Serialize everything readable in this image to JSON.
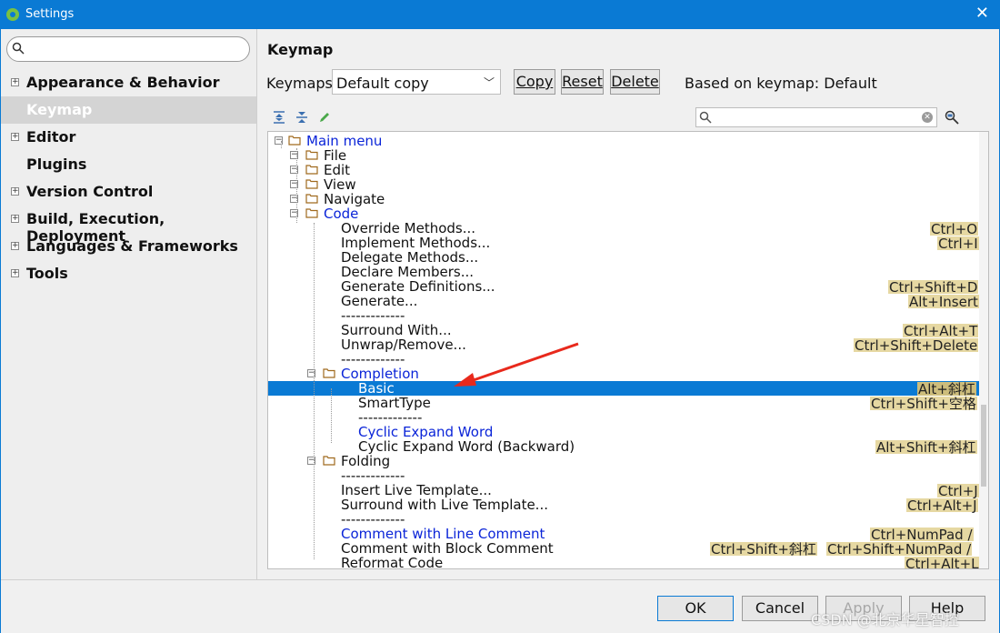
{
  "window": {
    "title": "Settings",
    "close": "✕"
  },
  "sidebar": {
    "items": [
      {
        "label": "Appearance & Behavior",
        "expand": "+"
      },
      {
        "label": "Keymap"
      },
      {
        "label": "Editor",
        "expand": "+"
      },
      {
        "label": "Plugins"
      },
      {
        "label": "Version Control",
        "expand": "+"
      },
      {
        "label": "Build, Execution, Deployment",
        "expand": "+"
      },
      {
        "label": "Languages & Frameworks",
        "expand": "+"
      },
      {
        "label": "Tools",
        "expand": "+"
      }
    ]
  },
  "keymap": {
    "heading": "Keymap",
    "keymaps_label": "Keymaps:",
    "selected_keymap": "Default copy",
    "copy_label": "Copy",
    "reset_label": "Reset",
    "delete_label": "Delete",
    "based_on": "Based on keymap: Default"
  },
  "tree": {
    "rows": [
      {
        "text": "Main menu",
        "blue": true
      },
      {
        "text": "File"
      },
      {
        "text": "Edit"
      },
      {
        "text": "View"
      },
      {
        "text": "Navigate"
      },
      {
        "text": "Code",
        "blue": true
      },
      {
        "text": "Override Methods...",
        "shortcuts": [
          "Ctrl+O"
        ]
      },
      {
        "text": "Implement Methods...",
        "shortcuts": [
          "Ctrl+I"
        ]
      },
      {
        "text": "Delegate Methods..."
      },
      {
        "text": "Declare Members..."
      },
      {
        "text": "Generate Definitions...",
        "shortcuts": [
          "Ctrl+Shift+D"
        ]
      },
      {
        "text": "Generate...",
        "shortcuts": [
          "Alt+Insert"
        ]
      },
      {
        "text": "-------------"
      },
      {
        "text": "Surround With...",
        "shortcuts": [
          "Ctrl+Alt+T"
        ]
      },
      {
        "text": "Unwrap/Remove...",
        "shortcuts": [
          "Ctrl+Shift+Delete"
        ]
      },
      {
        "text": "-------------"
      },
      {
        "text": "Completion",
        "blue": true
      },
      {
        "text": "Basic",
        "shortcuts": [
          "Alt+斜杠"
        ]
      },
      {
        "text": "SmartType",
        "shortcuts": [
          "Ctrl+Shift+空格"
        ]
      },
      {
        "text": "-------------"
      },
      {
        "text": "Cyclic Expand Word",
        "blue": true
      },
      {
        "text": "Cyclic Expand Word (Backward)",
        "shortcuts": [
          "Alt+Shift+斜杠"
        ]
      },
      {
        "text": "Folding"
      },
      {
        "text": "-------------"
      },
      {
        "text": "Insert Live Template...",
        "shortcuts": [
          "Ctrl+J"
        ]
      },
      {
        "text": "Surround with Live Template...",
        "shortcuts": [
          "Ctrl+Alt+J"
        ]
      },
      {
        "text": "-------------"
      },
      {
        "text": "Comment with Line Comment",
        "blue": true,
        "shortcuts": [
          "Ctrl+NumPad /"
        ]
      },
      {
        "text": "Comment with Block Comment",
        "shortcuts": [
          "Ctrl+Shift+斜杠",
          "Ctrl+Shift+NumPad /"
        ]
      },
      {
        "text": "Reformat Code",
        "shortcuts": [
          "Ctrl+Alt+L"
        ]
      }
    ]
  },
  "footer": {
    "ok": "OK",
    "cancel": "Cancel",
    "apply": "Apply",
    "help": "Help"
  },
  "watermark": "CSDN @北京华星智控"
}
